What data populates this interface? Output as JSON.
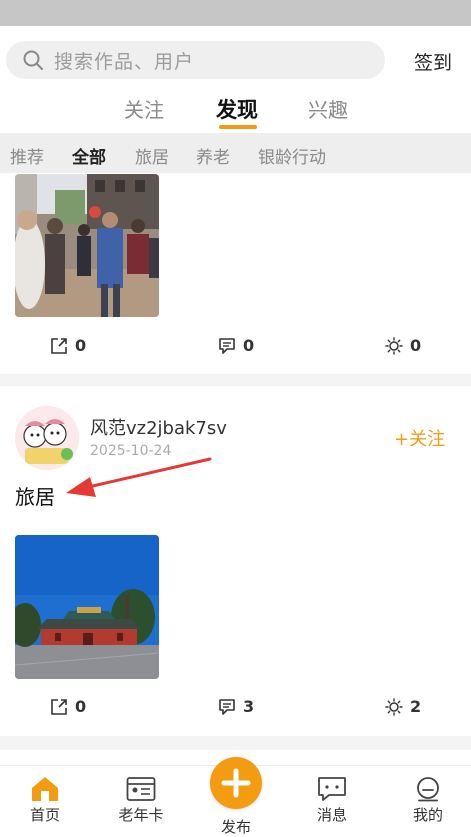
{
  "search": {
    "placeholder": "搜索作品、用户",
    "checkin_label": "签到"
  },
  "main_tabs": [
    {
      "label": "关注"
    },
    {
      "label": "发现"
    },
    {
      "label": "兴趣"
    }
  ],
  "sub_tabs": [
    {
      "label": "推荐"
    },
    {
      "label": "全部"
    },
    {
      "label": "旅居"
    },
    {
      "label": "养老"
    },
    {
      "label": "银龄行动"
    }
  ],
  "feed": {
    "post1": {
      "share_count": "0",
      "comment_count": "0",
      "like_count": "0"
    },
    "post2": {
      "username": "风范vz2jbak7sv",
      "date": "2025-10-24",
      "follow_label": "+关注",
      "text": "旅居",
      "share_count": "0",
      "comment_count": "3",
      "like_count": "2"
    }
  },
  "bottom_nav": [
    {
      "label": "首页"
    },
    {
      "label": "老年卡"
    },
    {
      "label": "发布"
    },
    {
      "label": "消息"
    },
    {
      "label": "我的"
    }
  ],
  "colors": {
    "accent": "#f39c12",
    "arrow": "#e53935"
  }
}
